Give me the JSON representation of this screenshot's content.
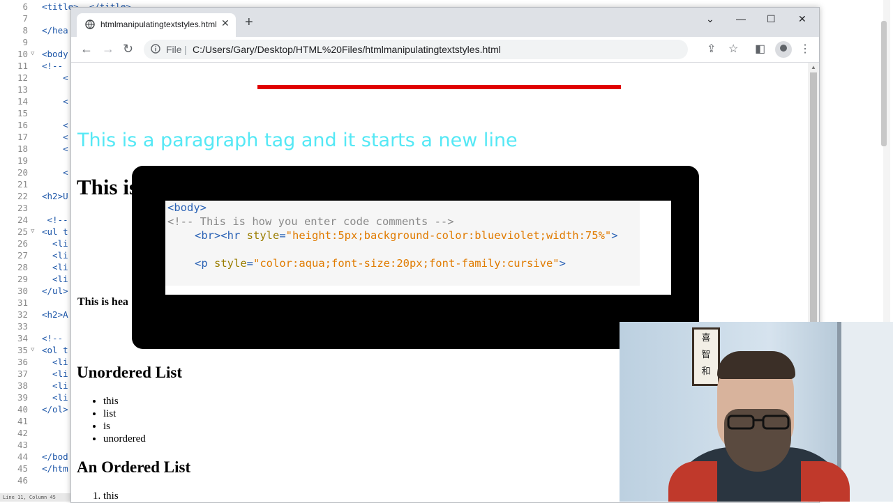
{
  "editor": {
    "lines": [
      {
        "num": "6",
        "fold": "",
        "code": "<title>  </title>"
      },
      {
        "num": "7",
        "fold": "",
        "code": ""
      },
      {
        "num": "8",
        "fold": "",
        "code": "</hea"
      },
      {
        "num": "9",
        "fold": "",
        "code": ""
      },
      {
        "num": "10",
        "fold": "▽",
        "code": "<body"
      },
      {
        "num": "11",
        "fold": "",
        "code": "<!--"
      },
      {
        "num": "12",
        "fold": "",
        "code": "    <"
      },
      {
        "num": "13",
        "fold": "",
        "code": ""
      },
      {
        "num": "14",
        "fold": "",
        "code": "    <"
      },
      {
        "num": "15",
        "fold": "",
        "code": ""
      },
      {
        "num": "16",
        "fold": "",
        "code": "    <"
      },
      {
        "num": "17",
        "fold": "",
        "code": "    <"
      },
      {
        "num": "18",
        "fold": "",
        "code": "    <"
      },
      {
        "num": "19",
        "fold": "",
        "code": ""
      },
      {
        "num": "20",
        "fold": "",
        "code": "    <"
      },
      {
        "num": "21",
        "fold": "",
        "code": ""
      },
      {
        "num": "22",
        "fold": "",
        "code": "<h2>U"
      },
      {
        "num": "23",
        "fold": "",
        "code": ""
      },
      {
        "num": "24",
        "fold": "",
        "code": " <!--"
      },
      {
        "num": "25",
        "fold": "▽",
        "code": "<ul t"
      },
      {
        "num": "26",
        "fold": "",
        "code": "  <li"
      },
      {
        "num": "27",
        "fold": "",
        "code": "  <li"
      },
      {
        "num": "28",
        "fold": "",
        "code": "  <li"
      },
      {
        "num": "29",
        "fold": "",
        "code": "  <li"
      },
      {
        "num": "30",
        "fold": "",
        "code": "</ul>"
      },
      {
        "num": "31",
        "fold": "",
        "code": ""
      },
      {
        "num": "32",
        "fold": "",
        "code": "<h2>A"
      },
      {
        "num": "33",
        "fold": "",
        "code": ""
      },
      {
        "num": "34",
        "fold": "",
        "code": "<!--"
      },
      {
        "num": "35",
        "fold": "▽",
        "code": "<ol t"
      },
      {
        "num": "36",
        "fold": "",
        "code": "  <li"
      },
      {
        "num": "37",
        "fold": "",
        "code": "  <li"
      },
      {
        "num": "38",
        "fold": "",
        "code": "  <li"
      },
      {
        "num": "39",
        "fold": "",
        "code": "  <li"
      },
      {
        "num": "40",
        "fold": "",
        "code": "</ol>"
      },
      {
        "num": "41",
        "fold": "",
        "code": ""
      },
      {
        "num": "42",
        "fold": "",
        "code": ""
      },
      {
        "num": "43",
        "fold": "",
        "code": ""
      },
      {
        "num": "44",
        "fold": "",
        "code": "</bod"
      },
      {
        "num": "45",
        "fold": "",
        "code": "</htm"
      },
      {
        "num": "46",
        "fold": "",
        "code": ""
      }
    ],
    "status": "Line 11, Column 45"
  },
  "browser": {
    "tab_title": "htmlmanipulatingtextstyles.html",
    "tab_close": "✕",
    "new_tab": "+",
    "window_controls": {
      "dropdown": "⌄",
      "minimize": "—",
      "maximize": "☐",
      "close": "✕"
    },
    "nav": {
      "back": "←",
      "forward": "→",
      "reload": "↻"
    },
    "address": {
      "scheme": "File",
      "separator": "|",
      "url": "C:/Users/Gary/Desktop/HTML%20Files/htmlmanipulatingtextstyles.html"
    },
    "toolbar_icons": {
      "share": "⇪",
      "bookmark": "☆",
      "sidepanel": "◧",
      "menu": "⋮"
    }
  },
  "page": {
    "paragraph": "This is a paragraph tag and it starts a new line",
    "heading1": "This is",
    "heading4": "This is hea",
    "ul_heading": "Unordered List",
    "ul_items": [
      "this",
      "list",
      "is",
      "unordered"
    ],
    "ol_heading": "An Ordered List",
    "ol_items": [
      "this"
    ]
  },
  "overlay": {
    "line1_tag": "<body>",
    "line2_comment": "<!-- This is how you enter code comments -->",
    "line3_tag_open": "<br><hr",
    "line3_attr": " style",
    "line3_eq": "=",
    "line3_value": "\"height:5px;background-color:blueviolet;width:75%\"",
    "line3_close": ">",
    "line4_tag_open": "<p",
    "line4_attr": " style",
    "line4_eq": "=",
    "line4_value": "\"color:aqua;font-size:20px;font-family:cursive\"",
    "line4_close": ">"
  },
  "webcam": {
    "scroll_chars": [
      "喜",
      "智",
      "和"
    ]
  },
  "colors": {
    "rule_red": "#e00000",
    "paragraph_aqua": "#55e8f5",
    "code_tag": "#2a62b5",
    "code_string": "#e07b00"
  }
}
